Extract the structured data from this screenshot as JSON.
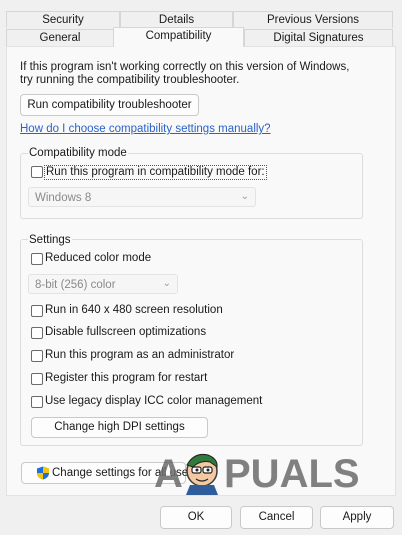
{
  "tabs": {
    "row1": [
      "Security",
      "Details",
      "Previous Versions"
    ],
    "row2": [
      "General",
      "Compatibility",
      "Digital Signatures"
    ]
  },
  "intro_text_1": "If this program isn't working correctly on this version of Windows,",
  "intro_text_2": "try running the compatibility troubleshooter.",
  "troubleshooter_button": "Run compatibility troubleshooter",
  "manual_link": "How do I choose compatibility settings manually?",
  "compat_mode": {
    "group_label": "Compatibility mode",
    "checkbox_label": "Run this program in compatibility mode for:",
    "checked": false,
    "dropdown_value": "Windows 8"
  },
  "settings": {
    "group_label": "Settings",
    "reduced_color": {
      "label": "Reduced color mode",
      "checked": false
    },
    "color_dropdown_value": "8-bit (256) color",
    "options": [
      {
        "label": "Run in 640 x 480 screen resolution",
        "checked": false
      },
      {
        "label": "Disable fullscreen optimizations",
        "checked": false
      },
      {
        "label": "Run this program as an administrator",
        "checked": false
      },
      {
        "label": "Register this program for restart",
        "checked": false
      },
      {
        "label": "Use legacy display ICC color management",
        "checked": false
      }
    ],
    "dpi_button": "Change high DPI settings"
  },
  "all_users_button": "Change settings for all users",
  "footer": {
    "ok": "OK",
    "cancel": "Cancel",
    "apply": "Apply"
  },
  "watermark": "APPUALS",
  "colors": {
    "link": "#2a62c8",
    "shield_blue": "#1e6fd9",
    "shield_yellow": "#f2c313"
  }
}
